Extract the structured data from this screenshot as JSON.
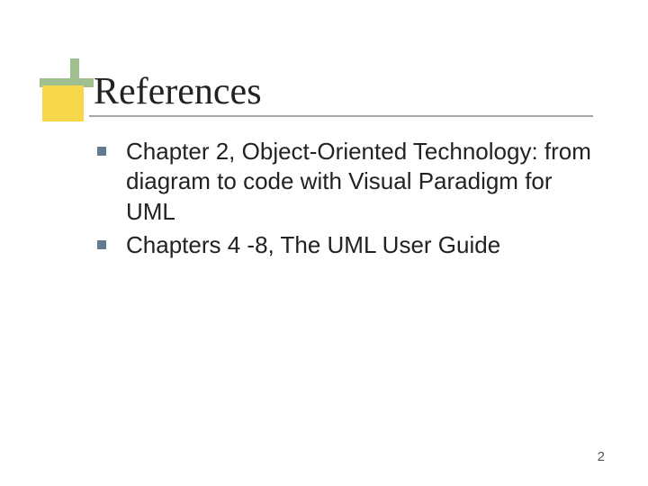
{
  "slide": {
    "title": "References",
    "items": [
      "Chapter 2, Object-Oriented Technology: from diagram to code with Visual Paradigm for UML",
      "Chapters 4 -8, The UML User Guide"
    ],
    "page_number": "2"
  }
}
